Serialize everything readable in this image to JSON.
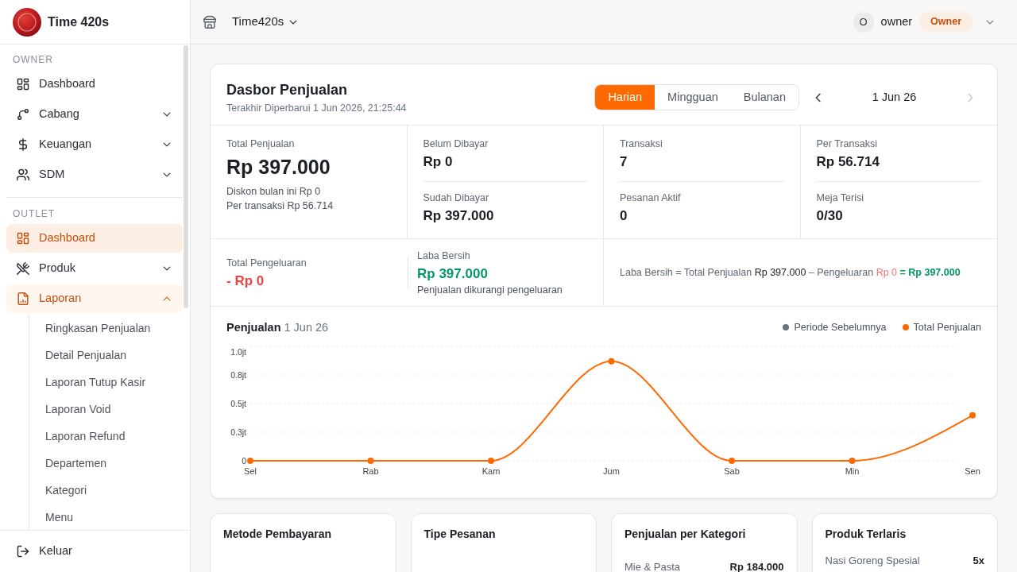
{
  "sidebar": {
    "brand": "Time 420s",
    "sections": [
      {
        "title": "OWNER",
        "items": [
          {
            "kind": "link",
            "label": "Dashboard",
            "selected": false
          },
          {
            "kind": "group",
            "label": "Cabang",
            "selected": false,
            "expanded": false
          },
          {
            "kind": "group",
            "label": "Keuangan",
            "selected": false,
            "expanded": false
          },
          {
            "kind": "group",
            "label": "SDM",
            "selected": false,
            "expanded": false
          }
        ]
      },
      {
        "title": "OUTLET",
        "items": [
          {
            "kind": "link",
            "label": "Dashboard",
            "selected": true
          },
          {
            "kind": "group",
            "label": "Produk",
            "selected": false,
            "expanded": false
          },
          {
            "kind": "group",
            "label": "Laporan",
            "selected": false,
            "expanded": true,
            "children": [
              {
                "label": "Ringkasan Penjualan",
                "selected": false
              },
              {
                "label": "Detail Penjualan",
                "selected": false
              },
              {
                "label": "Laporan Tutup Kasir",
                "selected": false
              },
              {
                "label": "Laporan Void",
                "selected": false
              },
              {
                "label": "Laporan Refund",
                "selected": false
              },
              {
                "label": "Departemen",
                "selected": false
              },
              {
                "label": "Kategori",
                "selected": false
              },
              {
                "label": "Menu",
                "selected": false
              }
            ]
          }
        ]
      }
    ],
    "logout": "Keluar"
  },
  "topbar": {
    "outlet": "Time420s",
    "user": {
      "initial": "O",
      "name": "owner",
      "role": "Owner"
    }
  },
  "sales_dashboard": {
    "title": "Dasbor Penjualan",
    "updated": "Terakhir Diperbarui 1 Jun 2026, 21:25:44",
    "periods": [
      {
        "label": "Harian",
        "selected": true
      },
      {
        "label": "Mingguan",
        "selected": false
      },
      {
        "label": "Bulanan",
        "selected": false
      }
    ],
    "date_nav": {
      "label": "1 Jun 26",
      "prev_disabled": false,
      "next_disabled": true
    },
    "total_sales": {
      "label": "Total Penjualan",
      "value": "Rp 397.000",
      "notes": [
        "Diskon bulan ini Rp 0",
        "Per transaksi Rp 56.714"
      ]
    },
    "stat_columns": [
      {
        "items": [
          {
            "label": "Belum Dibayar",
            "value": "Rp 0"
          },
          {
            "label": "Sudah Dibayar",
            "value": "Rp 397.000"
          }
        ]
      },
      {
        "items": [
          {
            "label": "Transaksi",
            "value": "7"
          },
          {
            "label": "Pesanan Aktif",
            "value": "0"
          }
        ]
      },
      {
        "items": [
          {
            "label": "Per Transaksi",
            "value": "Rp 56.714"
          },
          {
            "label": "Meja Terisi",
            "value": "0/30"
          }
        ]
      }
    ],
    "expenses": {
      "label": "Total Pengeluaran",
      "value": "- Rp 0"
    },
    "net_profit": {
      "label": "Laba Bersih",
      "value": "Rp 397.000",
      "note": "Penjualan dikurangi pengeluaran"
    },
    "formula": [
      {
        "kind": "text",
        "text": "Laba Bersih = Total Penjualan"
      },
      {
        "kind": "amount",
        "text": "Rp 397.000"
      },
      {
        "kind": "text",
        "text": "– Pengeluaran"
      },
      {
        "kind": "expense",
        "text": "Rp 0"
      },
      {
        "kind": "result",
        "text": "= Rp 397.000"
      }
    ],
    "chart": {
      "title": "Penjualan",
      "subtitle": "1 Jun 26",
      "chart_data": {
        "type": "line",
        "categories": [
          "Sel",
          "Rab",
          "Kam",
          "Jum",
          "Sab",
          "Min",
          "Sen"
        ],
        "series": [
          {
            "name": "Periode Sebelumnya",
            "color": "#6b7280",
            "values": [
              null,
              null,
              null,
              null,
              null,
              null,
              null
            ]
          },
          {
            "name": "Total Penjualan",
            "color": "#ff6a00",
            "marker": "circle",
            "values": [
              0,
              0,
              0,
              0.87,
              0,
              0,
              0.397
            ]
          }
        ],
        "ylim": [
          0,
          1
        ],
        "yticks": [
          {
            "value": 0,
            "label": "0"
          },
          {
            "value": 0.25,
            "label": "0.3jt"
          },
          {
            "value": 0.5,
            "label": "0.5jt"
          },
          {
            "value": 0.75,
            "label": "0.8jt"
          },
          {
            "value": 1,
            "label": "1.0jt"
          }
        ],
        "grid": true
      }
    }
  },
  "panels": [
    {
      "title": "Metode Pembayaran"
    },
    {
      "title": "Tipe Pesanan"
    },
    {
      "title": "Penjualan per Kategori",
      "rows": [
        {
          "label": "Mie & Pasta",
          "value": "Rp 184.000"
        }
      ]
    },
    {
      "title": "Produk Terlaris",
      "rows": [
        {
          "label": "Nasi Goreng Spesial",
          "value": "5x"
        }
      ]
    }
  ]
}
